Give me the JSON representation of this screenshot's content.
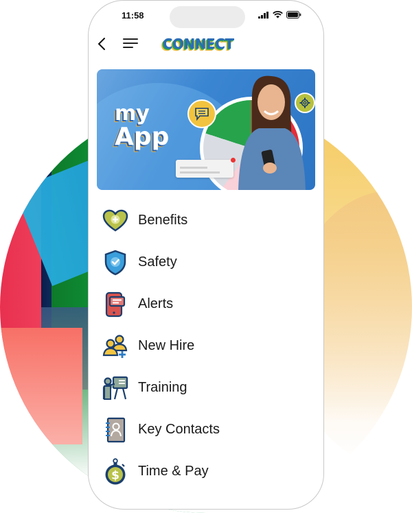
{
  "status_bar": {
    "time": "11:58"
  },
  "header": {
    "logo_text": "CONNECT"
  },
  "banner": {
    "line1": "my",
    "line2": "App"
  },
  "menu": {
    "items": [
      {
        "label": "Benefits",
        "icon": "heart-plus-icon"
      },
      {
        "label": "Safety",
        "icon": "shield-check-icon"
      },
      {
        "label": "Alerts",
        "icon": "phone-alert-icon"
      },
      {
        "label": "New Hire",
        "icon": "users-add-icon"
      },
      {
        "label": "Training",
        "icon": "presentation-icon"
      },
      {
        "label": "Key Contacts",
        "icon": "contact-book-icon"
      },
      {
        "label": "Time & Pay",
        "icon": "stopwatch-dollar-icon"
      }
    ]
  },
  "colors": {
    "navy": "#1b3f6e",
    "olive": "#b9c24a",
    "blue": "#3a9fdc",
    "red": "#d9534f",
    "yellow": "#f4c542"
  }
}
